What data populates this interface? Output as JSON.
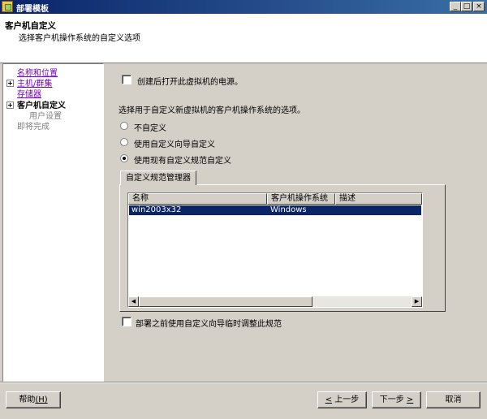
{
  "window": {
    "title": "部署模板",
    "controls": [
      "_",
      "□",
      "×"
    ]
  },
  "header": {
    "title": "客户机自定义",
    "subtitle": "选择客户机操作系统的自定义选项"
  },
  "nav": {
    "items": [
      {
        "label": "名称和位置",
        "state": "link"
      },
      {
        "label": "主机/群集",
        "state": "link"
      },
      {
        "label": "存储器",
        "state": "link"
      },
      {
        "label": "客户机自定义",
        "state": "current"
      },
      {
        "label": "用户设置",
        "state": "disabled"
      },
      {
        "label": "即将完成",
        "state": "disabled"
      }
    ]
  },
  "main": {
    "power_on_label": "创建后打开此虚拟机的电源。",
    "prompt": "选择用于自定义新虚拟机的客户机操作系统的选项。",
    "options": [
      {
        "label": "不自定义",
        "selected": false
      },
      {
        "label": "使用自定义向导自定义",
        "selected": false
      },
      {
        "label": "使用现有自定义规范自定义",
        "selected": true
      }
    ],
    "tab_label": "自定义规范管理器",
    "table": {
      "columns": [
        "名称",
        "客户机操作系统",
        "描述"
      ],
      "rows": [
        {
          "name": "win2003x32",
          "os": "Windows",
          "desc": ""
        }
      ]
    },
    "adjust_label": "部署之前使用自定义向导临时调整此规范"
  },
  "footer": {
    "help_label": "帮助",
    "help_key": "(H)",
    "back_label": "上一步",
    "back_key": "<",
    "next_label": "下一步",
    "next_key": ">",
    "cancel_label": "取消"
  }
}
